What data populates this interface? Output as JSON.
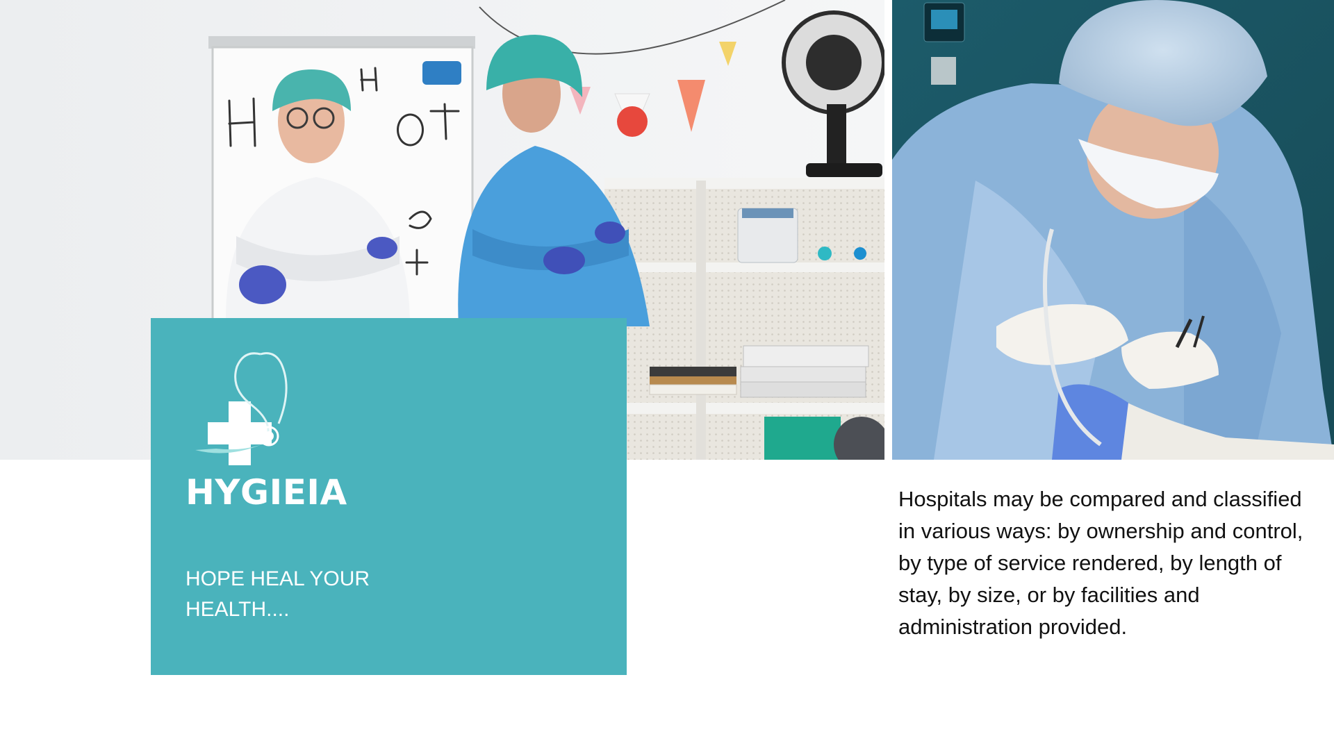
{
  "brand": {
    "name": "HYGIEIA",
    "tagline": "HOPE HEAL YOUR HEALTH....",
    "logo_icon": "medical-cross-stethoscope-icon",
    "card_color": "#4ab3bc"
  },
  "description": {
    "text": "Hospitals may be compared and classified in various ways: by ownership and control, by type of service rendered, by length of stay, by size, or by facilities and administration provided."
  },
  "photos": {
    "left": {
      "subject": "lab-staff-photo"
    },
    "right": {
      "subject": "surgeon-photo"
    }
  }
}
